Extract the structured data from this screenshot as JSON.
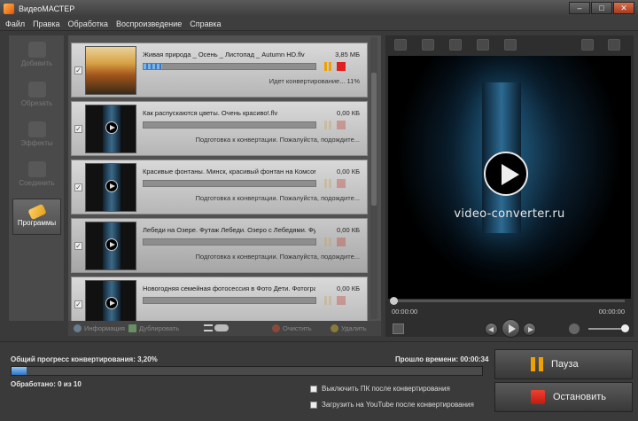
{
  "window": {
    "title": "ВидеоМАСТЕР",
    "min": "–",
    "max": "□",
    "close": "✕"
  },
  "menu": [
    "Файл",
    "Правка",
    "Обработка",
    "Воспроизведение",
    "Справка"
  ],
  "sidebar": {
    "items": [
      {
        "label": "Добавить",
        "icon": "add-video-icon",
        "active": false
      },
      {
        "label": "Обрезать",
        "icon": "cut-icon",
        "active": false
      },
      {
        "label": "Эффекты",
        "icon": "effects-icon",
        "active": false
      },
      {
        "label": "Соединить",
        "icon": "join-icon",
        "active": false
      },
      {
        "label": "Программы",
        "icon": "tag-icon",
        "active": true
      }
    ]
  },
  "files": [
    {
      "name": "Живая природа _ Осень _ Листопад _ Autumn HD.flv",
      "size": "3,85 МБ",
      "status": "Идет конвертирование... 11%",
      "progress": 0.11,
      "checked": true
    },
    {
      "name": "Как распускаются цветы. Очень красиво!.flv",
      "size": "0,00 КБ",
      "status": "Подготовка к конвертации. Пожалуйста, подождите...",
      "progress": 0,
      "checked": true
    },
    {
      "name": "Красивые фонтаны. Минск, красивый фонтан на Комсом",
      "size": "0,00 КБ",
      "status": "Подготовка к конвертации. Пожалуйста, подождите...",
      "progress": 0,
      "checked": true
    },
    {
      "name": "Лебеди на Озере. Футаж Лебеди. Озеро с Лебедями. Фу",
      "size": "0,00 КБ",
      "status": "Подготовка к конвертации. Пожалуйста, подождите...",
      "progress": 0,
      "checked": true
    },
    {
      "name": "Новогодняя семейная фотосессия в Фото Дети. Фотогра",
      "size": "0,00 КБ",
      "status": "",
      "progress": 0,
      "checked": true
    }
  ],
  "list_toolbar": {
    "info": "Информация",
    "duplicate": "Дублировать",
    "clear": "Очистить",
    "delete": "Удалить"
  },
  "preview": {
    "brand_text": "video-converter.ru",
    "time_current": "00:00:00",
    "time_total": "00:00:00"
  },
  "conversion": {
    "progress_label": "Общий прогресс конвертирования: 3,20%",
    "progress": 0.032,
    "elapsed_label": "Прошло времени: 00:00:34",
    "processed_label": "Обработано: 0 из 10",
    "option_shutdown": "Выключить ПК после конвертирования",
    "option_youtube": "Загрузить на YouTube после конвертирования",
    "pause_label": "Пауза",
    "stop_label": "Остановить"
  },
  "colors": {
    "accent": "#f0a000",
    "stop": "#e02020",
    "progress_blue": "#3a78c2"
  }
}
